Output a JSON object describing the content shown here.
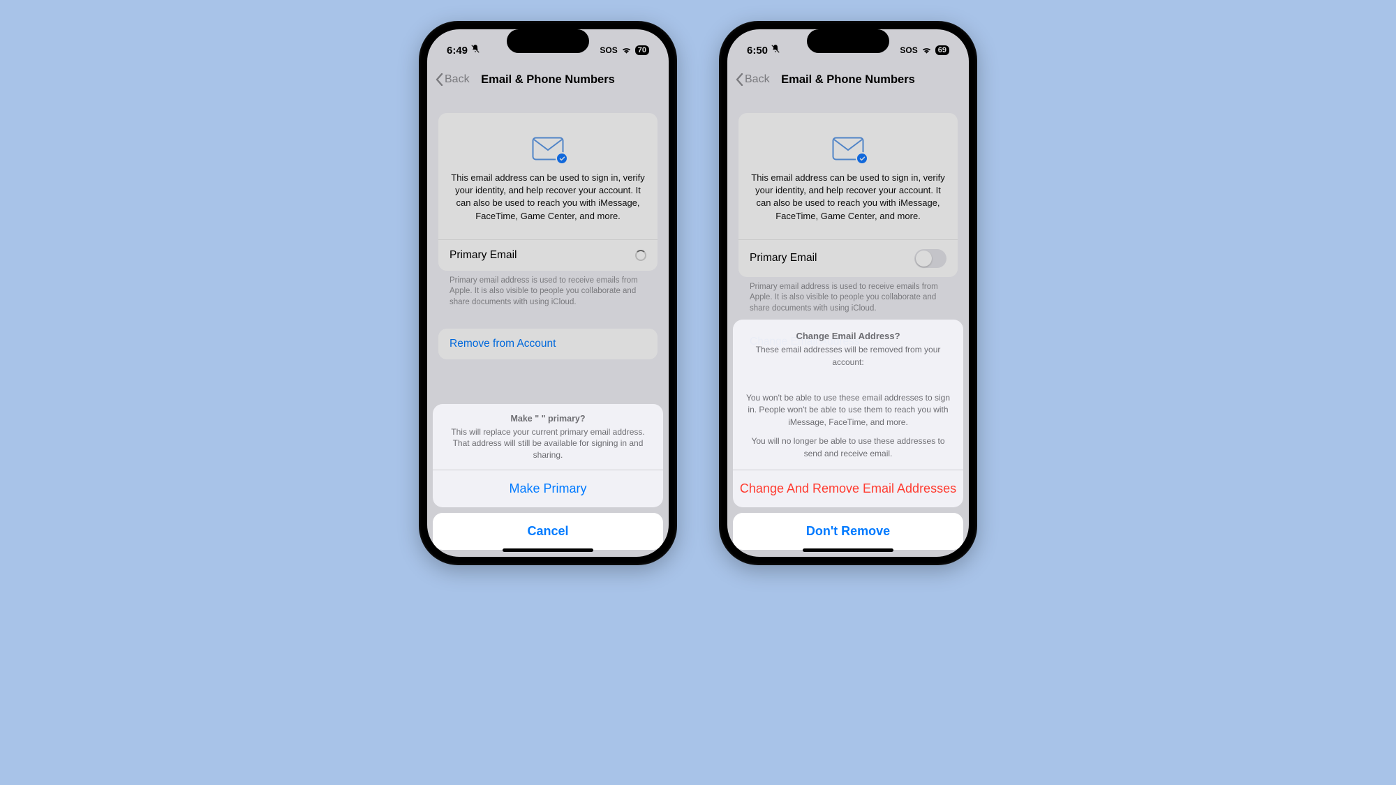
{
  "phoneA": {
    "status": {
      "time": "6:49",
      "sos": "SOS",
      "battery": "70"
    },
    "nav": {
      "back": "Back",
      "title": "Email & Phone Numbers"
    },
    "card": {
      "description": "This email address can be used to sign in, verify your identity, and help recover your account. It can also be used to reach you with iMessage, FaceTime, Game Center, and more.",
      "primary_label": "Primary Email",
      "footer": "Primary email address is used to receive emails from Apple. It is also visible to people you collaborate and share documents with using iCloud."
    },
    "remove_label": "Remove from Account",
    "sheet": {
      "title": "Make \"                                        \" primary?",
      "message": "This will replace your current primary email address. That address will still be available for signing in and sharing.",
      "action": "Make Primary",
      "cancel": "Cancel"
    }
  },
  "phoneB": {
    "status": {
      "time": "6:50",
      "sos": "SOS",
      "battery": "69"
    },
    "nav": {
      "back": "Back",
      "title": "Email & Phone Numbers"
    },
    "card": {
      "description": "This email address can be used to sign in, verify your identity, and help recover your account. It can also be used to reach you with iMessage, FaceTime, Game Center, and more.",
      "primary_label": "Primary Email",
      "footer": "Primary email address is used to receive emails from Apple. It is also visible to people you collaborate and share documents with using iCloud.",
      "change_label": "Change Email Address"
    },
    "alert": {
      "title": "Change Email Address?",
      "line1": "These email addresses will be removed from your account:",
      "line2": "You won't be able to use these email addresses to sign in. People won't be able to use them to reach you with iMessage, FaceTime, and more.",
      "line3": "You will no longer be able to use these addresses to send and receive email.",
      "action": "Change And Remove Email Addresses",
      "cancel": "Don't Remove"
    }
  }
}
